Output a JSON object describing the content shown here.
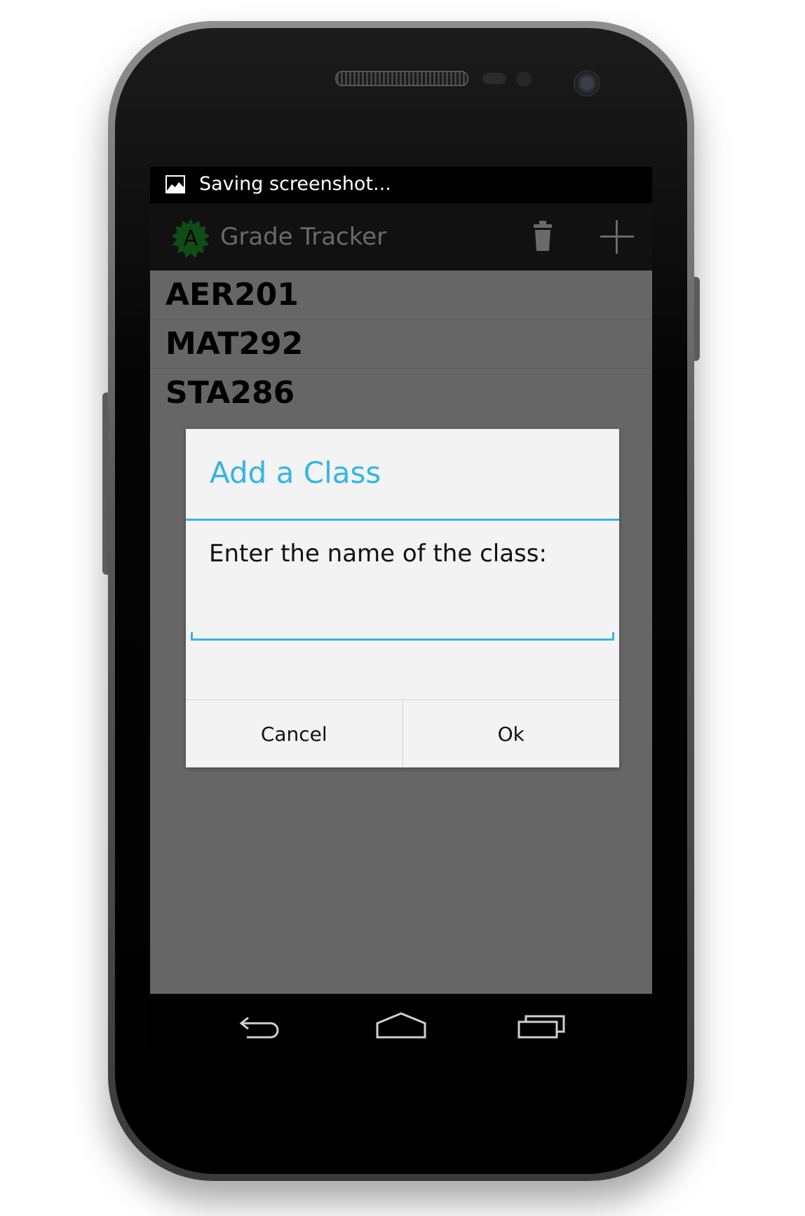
{
  "status_bar": {
    "notification_icon": "image-icon",
    "text": "Saving screenshot..."
  },
  "action_bar": {
    "logo_letter": "A",
    "title": "Grade Tracker",
    "actions": [
      "trash-icon",
      "plus-icon"
    ]
  },
  "classes": [
    {
      "name": "AER201"
    },
    {
      "name": "MAT292"
    },
    {
      "name": "STA286"
    }
  ],
  "dialog": {
    "title": "Add a Class",
    "message": "Enter the name of the class:",
    "input_value": "",
    "cancel_label": "Cancel",
    "ok_label": "Ok"
  },
  "nav_bar": {
    "buttons": [
      "back-icon",
      "home-icon",
      "recent-apps-icon"
    ]
  },
  "colors": {
    "accent": "#33b5e5",
    "screen_background": "#666666",
    "action_bar": "#111111",
    "logo_green": "#0f4d14"
  }
}
